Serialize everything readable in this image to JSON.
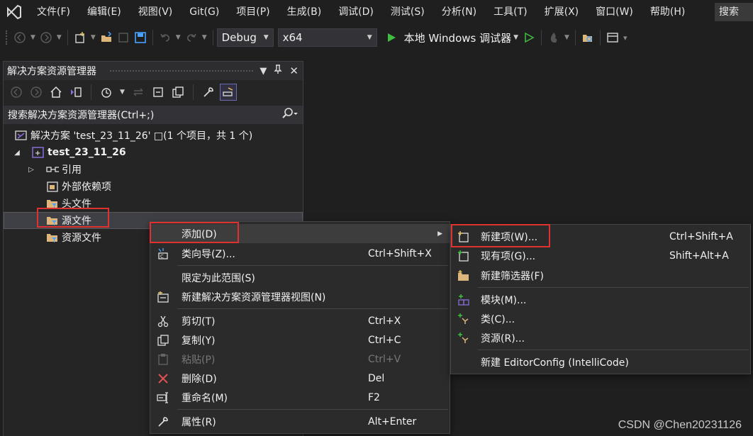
{
  "menubar": {
    "items": [
      "文件(F)",
      "编辑(E)",
      "视图(V)",
      "Git(G)",
      "项目(P)",
      "生成(B)",
      "调试(D)",
      "测试(S)",
      "分析(N)",
      "工具(T)",
      "扩展(X)",
      "窗口(W)",
      "帮助(H)"
    ],
    "search": "搜索"
  },
  "toolbar": {
    "config": "Debug",
    "platform": "x64",
    "run_label": "本地 Windows 调试器"
  },
  "solution_explorer": {
    "title": "解决方案资源管理器",
    "search_placeholder": "搜索解决方案资源管理器(Ctrl+;)",
    "solution": "解决方案 'test_23_11_26' □(1 个项目，共 1 个)",
    "project": "test_23_11_26",
    "nodes": {
      "references": "引用",
      "external": "外部依赖项",
      "headers": "头文件",
      "sources": "源文件",
      "resources": "资源文件"
    }
  },
  "context_menu": {
    "add": "添加(D)",
    "class_wizard": "类向导(Z)...",
    "class_wizard_sc": "Ctrl+Shift+X",
    "scope": "限定为此范围(S)",
    "new_view": "新建解决方案资源管理器视图(N)",
    "cut": "剪切(T)",
    "cut_sc": "Ctrl+X",
    "copy": "复制(Y)",
    "copy_sc": "Ctrl+C",
    "paste": "粘贴(P)",
    "paste_sc": "Ctrl+V",
    "delete": "删除(D)",
    "delete_sc": "Del",
    "rename": "重命名(M)",
    "rename_sc": "F2",
    "properties": "属性(R)",
    "properties_sc": "Alt+Enter"
  },
  "add_submenu": {
    "new_item": "新建项(W)...",
    "new_item_sc": "Ctrl+Shift+A",
    "existing_item": "现有项(G)...",
    "existing_item_sc": "Shift+Alt+A",
    "new_filter": "新建筛选器(F)",
    "module": "模块(M)...",
    "class": "类(C)...",
    "resource": "资源(R)...",
    "editorconfig": "新建 EditorConfig (IntelliCode)"
  },
  "watermark": "CSDN @Chen20231126",
  "colors": {
    "background": "#1f1f1f",
    "panel": "#252526",
    "menu": "#2b2b2b",
    "highlight_box": "#e03131",
    "run_green": "#3fbf3f",
    "folder_yellow": "#dcb67a",
    "vs_purple": "#8a6dd8"
  }
}
